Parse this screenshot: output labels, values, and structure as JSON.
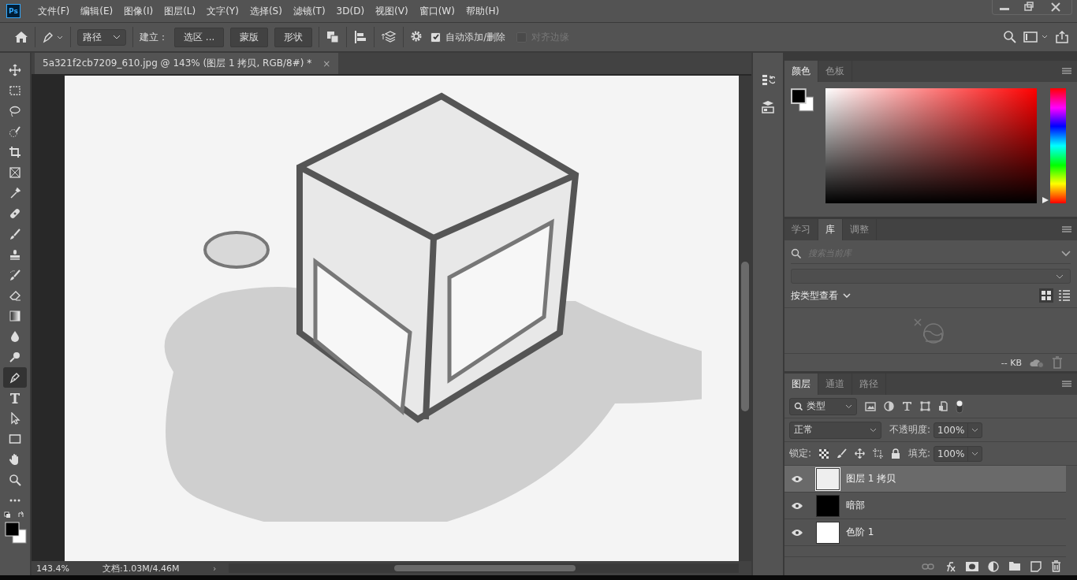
{
  "app_logo": "Ps",
  "menu": {
    "items": [
      "文件(F)",
      "编辑(E)",
      "图像(I)",
      "图层(L)",
      "文字(Y)",
      "选择(S)",
      "滤镜(T)",
      "3D(D)",
      "视图(V)",
      "窗口(W)",
      "帮助(H)"
    ]
  },
  "options_bar": {
    "mode": "路径",
    "build_label": "建立：",
    "build_buttons": [
      "选区 ...",
      "蒙版",
      "形状"
    ],
    "options": [
      {
        "label": "自动添加/删除",
        "checked": true,
        "disabled": false
      },
      {
        "label": "对齐边缘",
        "checked": false,
        "disabled": true
      }
    ]
  },
  "document_tab": {
    "title": "5a321f2cb7209_610.jpg @ 143% (图层 1 拷贝, RGB/8#) *",
    "close": "×"
  },
  "tools": [
    {
      "kind": "move",
      "selected": false
    },
    {
      "kind": "marquee",
      "selected": false
    },
    {
      "kind": "lasso",
      "selected": false
    },
    {
      "kind": "quick-select",
      "selected": false
    },
    {
      "kind": "crop",
      "selected": false
    },
    {
      "kind": "frame",
      "selected": false
    },
    {
      "kind": "eyedropper",
      "selected": false
    },
    {
      "kind": "healing",
      "selected": false
    },
    {
      "kind": "brush",
      "selected": false
    },
    {
      "kind": "stamp",
      "selected": false
    },
    {
      "kind": "history-brush",
      "selected": false
    },
    {
      "kind": "eraser",
      "selected": false
    },
    {
      "kind": "gradient",
      "selected": false
    },
    {
      "kind": "blur",
      "selected": false
    },
    {
      "kind": "dodge",
      "selected": false
    },
    {
      "kind": "pen",
      "selected": true
    },
    {
      "kind": "type",
      "selected": false
    },
    {
      "kind": "path-select",
      "selected": false
    },
    {
      "kind": "rectangle",
      "selected": false
    },
    {
      "kind": "hand",
      "selected": false
    },
    {
      "kind": "zoom",
      "selected": false
    },
    {
      "kind": "more",
      "selected": false
    }
  ],
  "status_bar": {
    "zoom": "143.4%",
    "document": "文档:1.03M/4.46M",
    "arrow": "›"
  },
  "color_panel": {
    "tabs": [
      {
        "label": "颜色",
        "selected": true
      },
      {
        "label": "色板",
        "selected": false
      }
    ],
    "hue": {
      "level": 0
    }
  },
  "library_panel": {
    "tabs": [
      {
        "label": "学习",
        "selected": false
      },
      {
        "label": "库",
        "selected": true
      },
      {
        "label": "调整",
        "selected": false
      }
    ],
    "search": {
      "placeholder": "搜索当前库"
    },
    "view_by": "按类型查看",
    "size": "-- KB"
  },
  "layers_panel": {
    "tabs": [
      {
        "label": "图层",
        "selected": true
      },
      {
        "label": "通道",
        "selected": false
      },
      {
        "label": "路径",
        "selected": false
      }
    ],
    "filter": "类型",
    "blend_mode": "正常",
    "opacity_label": "不透明度:",
    "opacity": "100%",
    "lock_label": "锁定:",
    "fill_label": "填充:",
    "fill": "100%",
    "layers": [
      {
        "name": "图层 1 拷贝",
        "visible": true,
        "selected": true,
        "kind": "light"
      },
      {
        "name": "暗部",
        "visible": true,
        "selected": false,
        "kind": "dark"
      },
      {
        "name": "色阶 1",
        "visible": true,
        "selected": false,
        "kind": "adjustment"
      }
    ]
  }
}
